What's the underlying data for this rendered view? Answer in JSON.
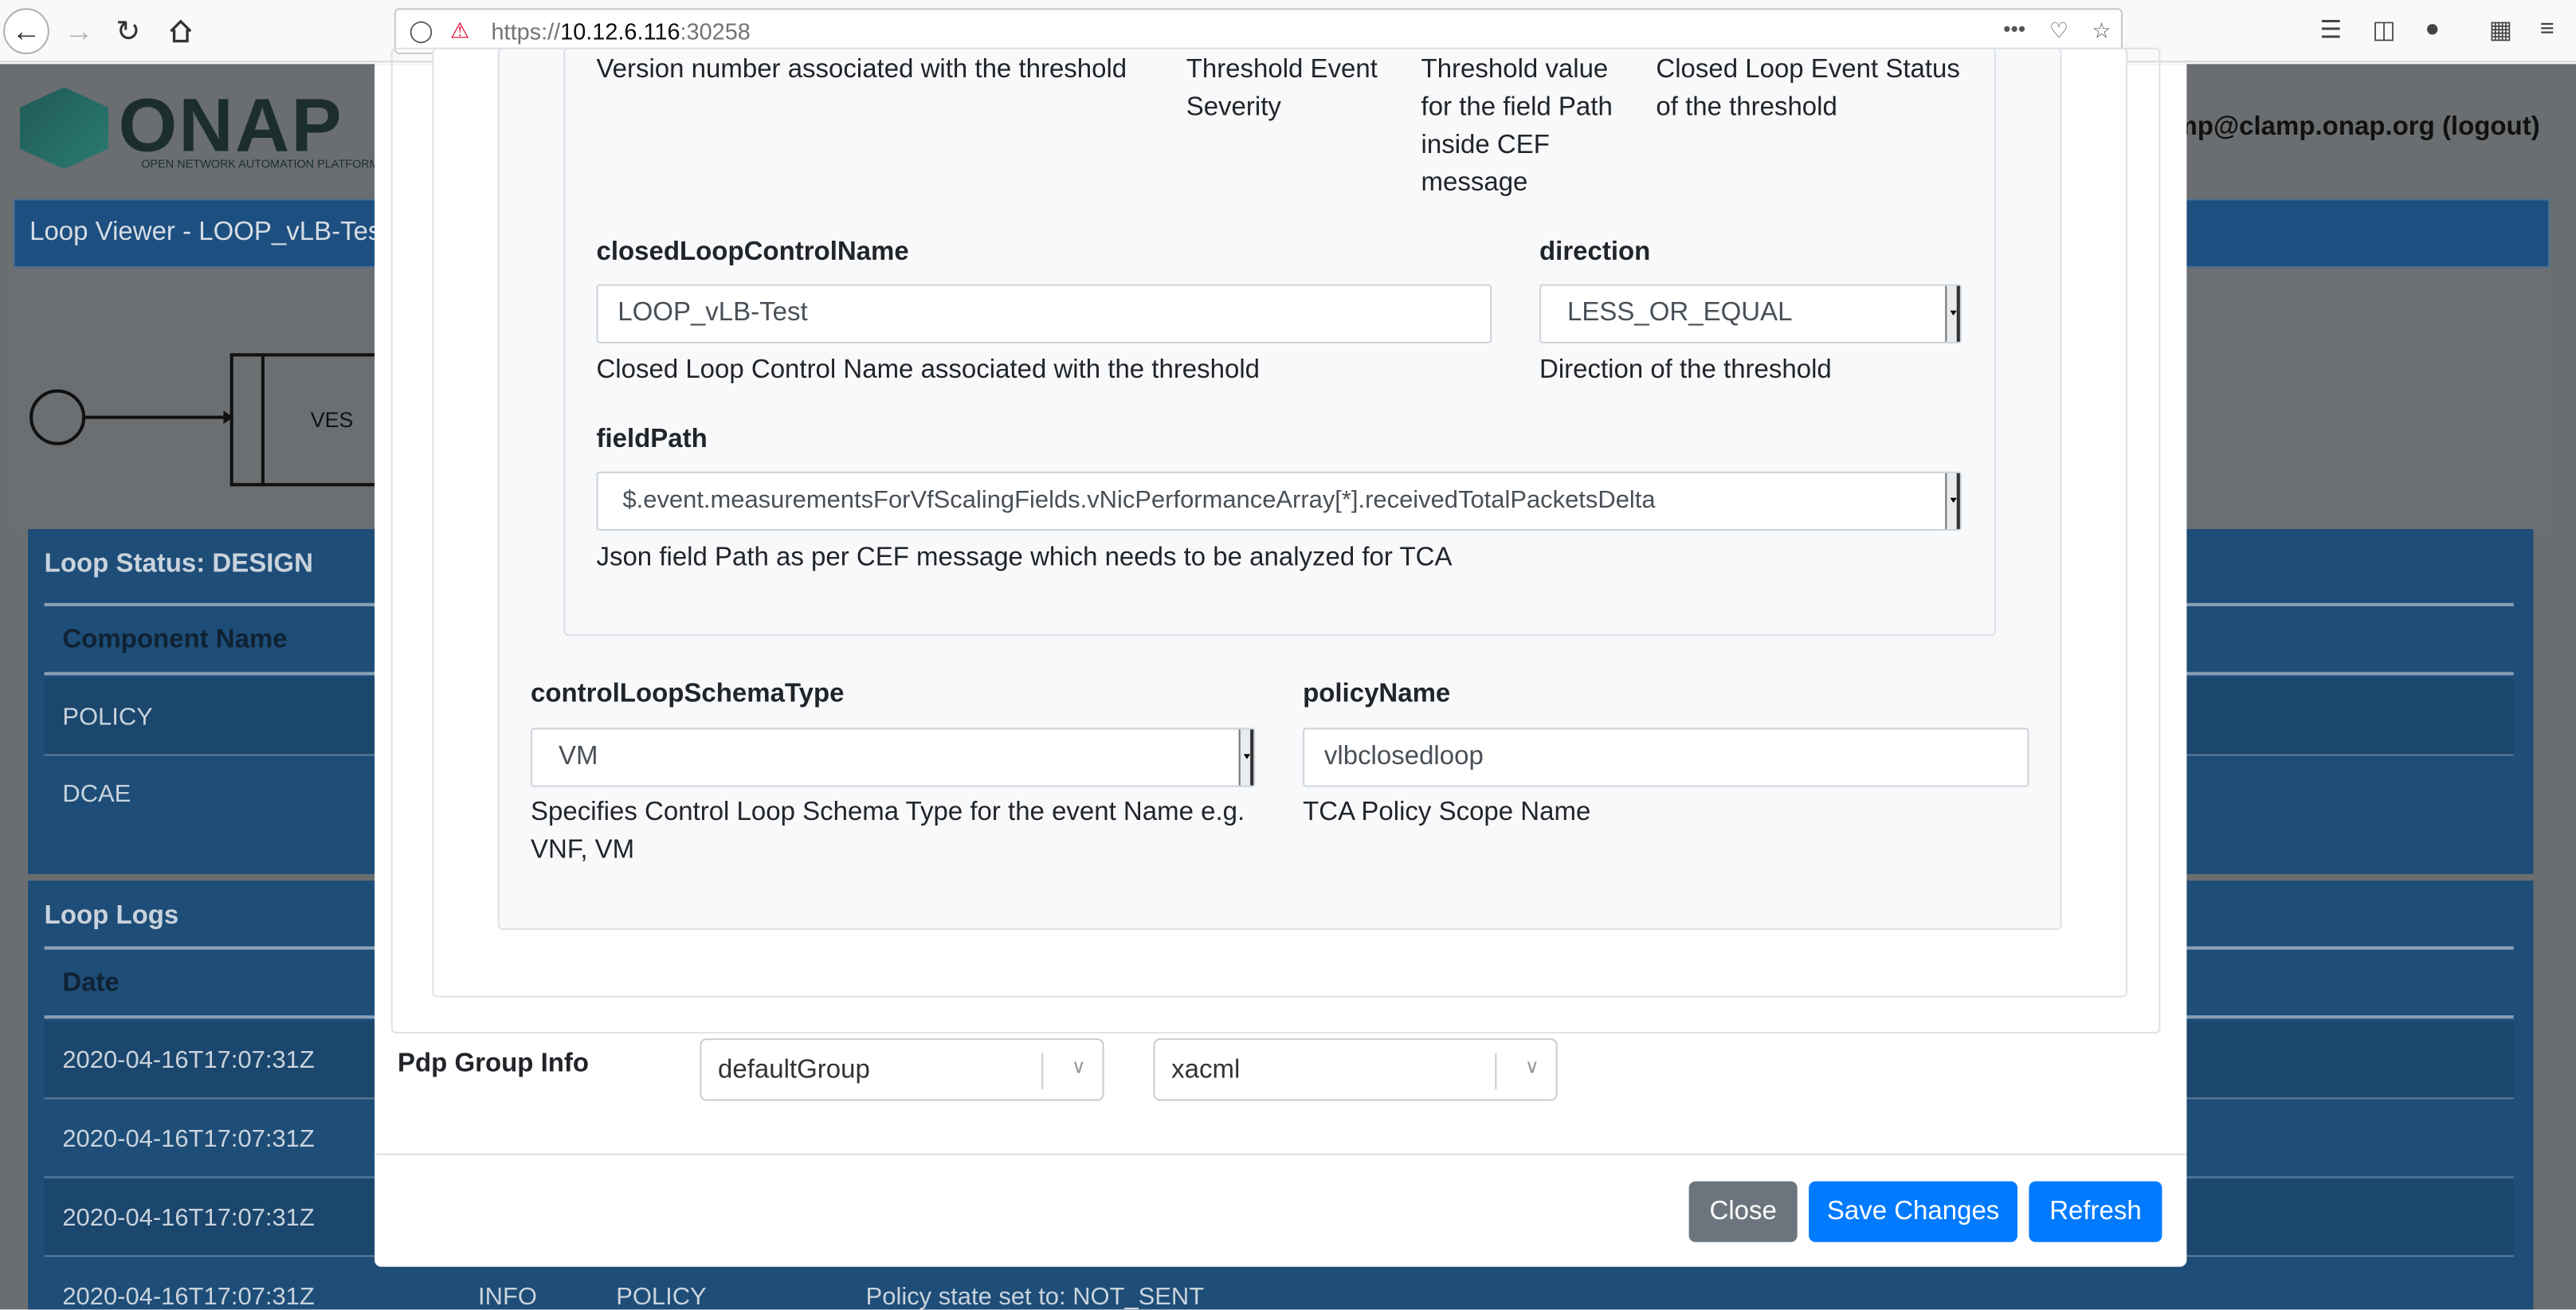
{
  "browser": {
    "url_prefix": "https://",
    "url_host": "10.12.6.116",
    "url_port": ":30258",
    "menu_dots": "•••"
  },
  "app": {
    "logo_text": "ONAP",
    "logo_subtitle": "OPEN NETWORK AUTOMATION PLATFORM",
    "user": "mp@clamp.onap.org (logout)",
    "loop_viewer_title": "Loop Viewer - LOOP_vLB-Test",
    "ves_label": "VES",
    "status_title": "Loop Status: DESIGN",
    "status_header": "Component Name",
    "status_rows": [
      "POLICY",
      "DCAE"
    ],
    "logs_title": "Loop Logs",
    "logs_header": "Date",
    "log_rows": [
      {
        "date": "2020-04-16T17:07:31Z"
      },
      {
        "date": "2020-04-16T17:07:31Z"
      },
      {
        "date": "2020-04-16T17:07:31Z"
      },
      {
        "date": "2020-04-16T17:07:31Z",
        "level": "INFO",
        "component": "POLICY",
        "message": "Policy state set to: NOT_SENT"
      }
    ]
  },
  "modal": {
    "desc_version": "Version number associated with the threshold",
    "desc_severity": "Threshold Event Severity",
    "desc_threshold_value": "Threshold value for the field Path inside CEF message",
    "desc_closed_loop_status": "Closed Loop Event Status of the threshold",
    "closed_loop_name": {
      "label": "closedLoopControlName",
      "value": "LOOP_vLB-Test",
      "description": "Closed Loop Control Name associated with the threshold"
    },
    "direction": {
      "label": "direction",
      "value": "LESS_OR_EQUAL",
      "description": "Direction of the threshold"
    },
    "field_path": {
      "label": "fieldPath",
      "value": "$.event.measurementsForVfScalingFields.vNicPerformanceArray[*].receivedTotalPacketsDelta",
      "description": "Json field Path as per CEF message which needs to be analyzed for TCA"
    },
    "schema_type": {
      "label": "controlLoopSchemaType",
      "value": "VM",
      "description": "Specifies Control Loop Schema Type for the event Name e.g. VNF, VM"
    },
    "policy_name": {
      "label": "policyName",
      "value": "vlbclosedloop",
      "description": "TCA Policy Scope Name"
    },
    "pdp": {
      "label": "Pdp Group Info",
      "group": "defaultGroup",
      "subgroup": "xacml"
    },
    "buttons": {
      "close": "Close",
      "save": "Save Changes",
      "refresh": "Refresh"
    }
  }
}
